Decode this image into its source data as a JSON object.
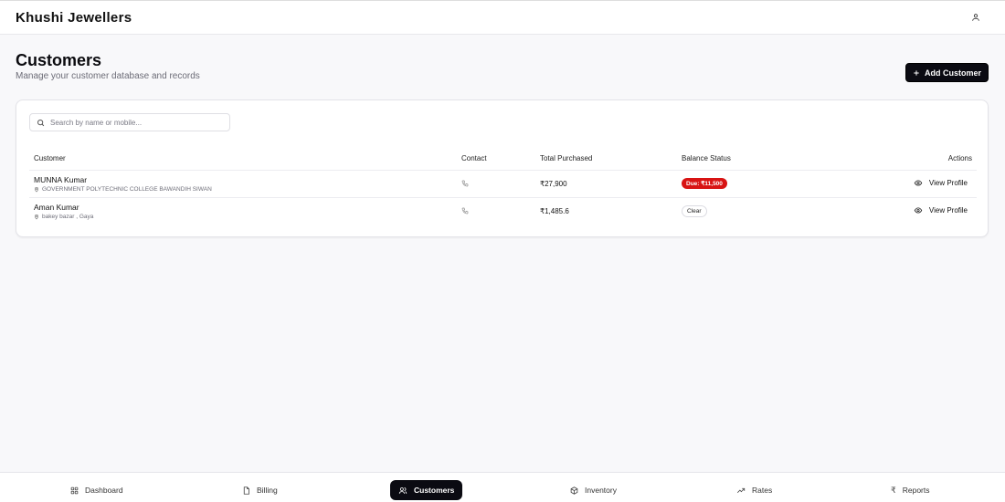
{
  "app": {
    "title": "Khushi Jewellers"
  },
  "page": {
    "title": "Customers",
    "subtitle": "Manage your customer database and records",
    "add_button_label": "Add Customer"
  },
  "search": {
    "placeholder": "Search by name or mobile...",
    "value": ""
  },
  "table": {
    "headers": {
      "customer": "Customer",
      "contact": "Contact",
      "total": "Total Purchased",
      "balance": "Balance Status",
      "actions": "Actions"
    },
    "rows": [
      {
        "name": "MUNNA Kumar",
        "address": "GOVERNMENT POLYTECHNIC COLLEGE BAWANDIH SIWAN",
        "total": "₹27,900",
        "balance": "Due: ₹11,500",
        "balance_status": "due",
        "action": "View Profile"
      },
      {
        "name": "Aman Kumar",
        "address": "bakey bazar , Gaya",
        "total": "₹1,485.6",
        "balance": "Clear",
        "balance_status": "clear",
        "action": "View Profile"
      }
    ]
  },
  "nav": {
    "items": [
      {
        "label": "Dashboard",
        "icon": "dashboard-icon"
      },
      {
        "label": "Billing",
        "icon": "billing-icon"
      },
      {
        "label": "Customers",
        "icon": "users-icon",
        "active": true
      },
      {
        "label": "Inventory",
        "icon": "box-icon"
      },
      {
        "label": "Rates",
        "icon": "trending-up-icon"
      },
      {
        "label": "Reports",
        "icon": "rupee-icon"
      }
    ]
  },
  "colors": {
    "accent": "#0b0b12",
    "due_badge": "#d81414",
    "background": "#f8f8fa"
  }
}
